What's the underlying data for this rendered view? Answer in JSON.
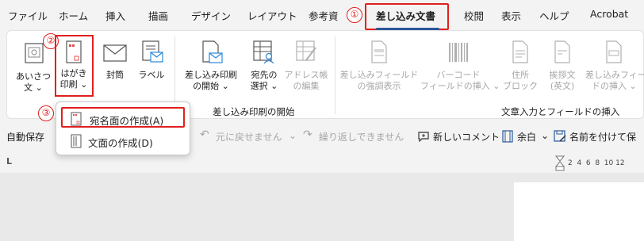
{
  "tabs": [
    {
      "label": "ファイル"
    },
    {
      "label": "ホーム"
    },
    {
      "label": "挿入"
    },
    {
      "label": "描画"
    },
    {
      "label": "デザイン"
    },
    {
      "label": "レイアウト"
    },
    {
      "label": "参考資"
    },
    {
      "label": "差し込み文書"
    },
    {
      "label": "校閲"
    },
    {
      "label": "表示"
    },
    {
      "label": "ヘルプ"
    },
    {
      "label": "Acrobat"
    }
  ],
  "annotations": {
    "one": "①",
    "two": "②",
    "three": "③"
  },
  "ribbon": {
    "greeting": {
      "line1": "あいさつ",
      "line2": "文 ⌄"
    },
    "postcard": {
      "line1": "はがき",
      "line2": "印刷 ⌄"
    },
    "envelope": {
      "line1": "封筒"
    },
    "label": {
      "line1": "ラベル"
    },
    "mailmerge_start": {
      "line1": "差し込み印刷",
      "line2": "の開始 ⌄"
    },
    "select_recipients": {
      "line1": "宛先の",
      "line2": "選択 ⌄"
    },
    "edit_list": {
      "line1": "アドレス帳",
      "line2": "の編集"
    },
    "highlight_fields": {
      "line1": "差し込みフィールド",
      "line2": "の強調表示"
    },
    "barcode": {
      "line1": "バーコード",
      "line2": "フィールドの挿入 ⌄"
    },
    "address_block": {
      "line1": "住所",
      "line2": "ブロック"
    },
    "greeting_line": {
      "line1": "挨拶文",
      "line2": "(英文)"
    },
    "insert_field": {
      "line1": "差し込みフィー",
      "line2": "ドの挿入 ⌄"
    },
    "group_mailmerge": "差し込み印刷の開始",
    "group_write_insert": "文章入力とフィールドの挿入"
  },
  "qab": {
    "autosave": "自動保存",
    "undo": "元に戻せません",
    "redo": "繰り返しできません",
    "new_comment": "新しいコメント",
    "margins": "余白",
    "save_as": "名前を付けて保"
  },
  "ruler": {
    "marks": "2  4  6  8  10 12",
    "tab_marker": "L"
  },
  "menu": {
    "items": [
      {
        "label": "宛名面の作成(A)"
      },
      {
        "label": "文面の作成(D)"
      }
    ]
  },
  "colors": {
    "accent": "#2b579a",
    "annotation": "#e0201e"
  }
}
